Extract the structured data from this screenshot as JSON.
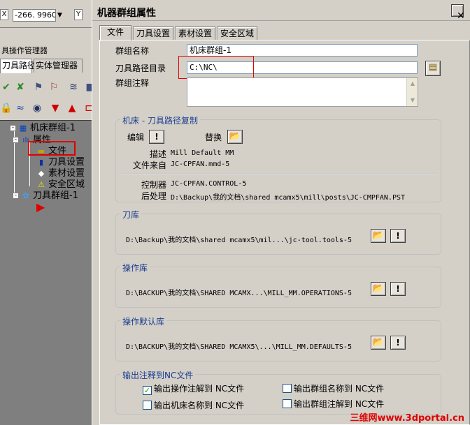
{
  "background_app": {
    "coord_axis_label": "Y",
    "coord_value": "-266. 9960",
    "left_label": "X",
    "operation_manager_title": "具操作管理器",
    "tabs": [
      "刀具路径",
      "实体管理器"
    ],
    "tree": {
      "root": "机床群组-1",
      "properties": "属性",
      "children": [
        "文件",
        "刀具设置",
        "素材设置",
        "安全区域"
      ],
      "toolpath_group": "刀具群组-1"
    }
  },
  "dialog": {
    "title": "机器群组属性",
    "close_icon": "close-icon",
    "tabs": [
      "文件",
      "刀具设置",
      "素材设置",
      "安全区域"
    ],
    "active_tab": "文件",
    "group_name_label": "群组名称",
    "group_name_value": "机床群组-1",
    "toolpath_dir_label": "刀具路径目录",
    "toolpath_dir_value": "C:\\NC\\",
    "group_comment_label": "群组注释",
    "group_comment_value": "",
    "copy_section": {
      "title": "机床 - 刀具路径复制",
      "edit_label": "编辑",
      "replace_label": "替换",
      "description_label": "描述",
      "description_value": "Mill Default MM",
      "file_source_label": "文件来自",
      "file_source_value": "JC-CPFAN.mmd-5",
      "controller_label": "控制器",
      "controller_value": "JC-CPFAN.CONTROL-5",
      "post_label": "后处理",
      "post_value": "D:\\Backup\\我的文档\\shared mcamx5\\mill\\posts\\JC-CMPFAN.PST"
    },
    "tool_library": {
      "title": "刀库",
      "path": "D:\\Backup\\我的文档\\shared mcamx5\\mil...\\jc-tool.tools-5"
    },
    "operation_library": {
      "title": "操作库",
      "path": "D:\\BACKUP\\我的文档\\SHARED MCAMX...\\MILL_MM.OPERATIONS-5"
    },
    "operation_defaults": {
      "title": "操作默认库",
      "path": "D:\\BACKUP\\我的文档\\SHARED MCAMX5\\...\\MILL_MM.DEFAULTS-5"
    },
    "nc_output": {
      "title": "输出注释到NC文件",
      "options": [
        {
          "label": "输出操作注解到 NC文件",
          "checked": true
        },
        {
          "label": "输出群组名称到 NC文件",
          "checked": false
        },
        {
          "label": "输出机床名称到 NC文件",
          "checked": false
        },
        {
          "label": "输出群组注解到 NC文件",
          "checked": false
        }
      ]
    }
  },
  "watermark": "三维网www.3dportal.cn"
}
